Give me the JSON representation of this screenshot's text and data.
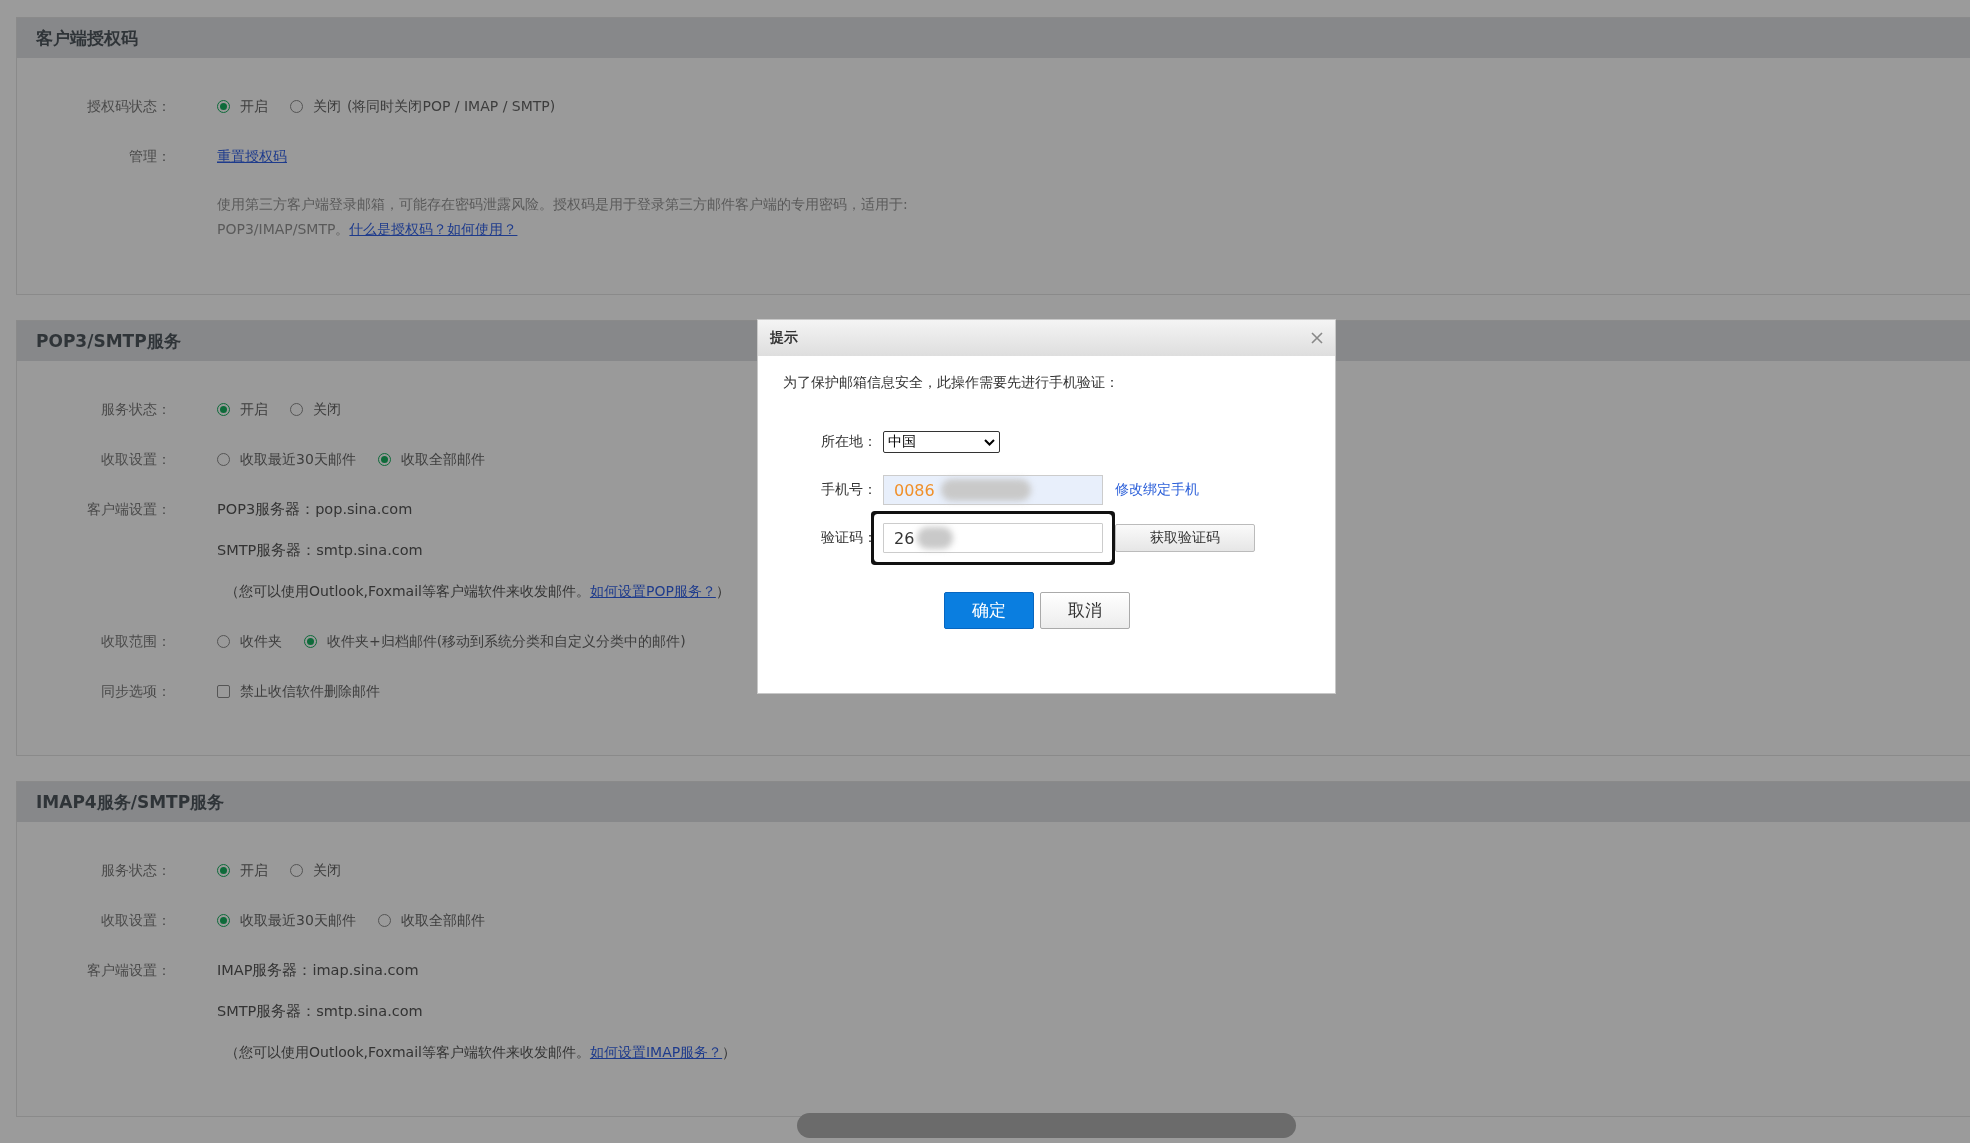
{
  "sections": [
    {
      "title": "客户端授权码",
      "rows": [
        {
          "kind": "radio",
          "label": "授权码状态：",
          "options": [
            {
              "label": "开启",
              "selected": true
            },
            {
              "label": "关闭",
              "selected": false,
              "note": "(将同时关闭POP / IMAP / SMTP)"
            }
          ]
        },
        {
          "kind": "link",
          "label": "管理：",
          "link": "重置授权码"
        },
        {
          "kind": "paragraph",
          "text": "使用第三方客户端登录邮箱，可能存在密码泄露风险。授权码是用于登录第三方邮件客户端的专用密码，适用于: POP3/IMAP/SMTP。",
          "link": "什么是授权码？如何使用？"
        }
      ]
    },
    {
      "title": "POP3/SMTP服务",
      "rows": [
        {
          "kind": "radio",
          "label": "服务状态：",
          "options": [
            {
              "label": "开启",
              "selected": true
            },
            {
              "label": "关闭",
              "selected": false
            }
          ]
        },
        {
          "kind": "radio",
          "label": "收取设置：",
          "options": [
            {
              "label": "收取最近30天邮件",
              "selected": false
            },
            {
              "label": "收取全部邮件",
              "selected": true
            }
          ]
        },
        {
          "kind": "servers",
          "label": "客户端设置：",
          "lines": [
            "POP3服务器：pop.sina.com",
            "SMTP服务器：smtp.sina.com"
          ],
          "note": {
            "before": "（您可以使用Outlook,Foxmail等客户端软件来收发邮件。",
            "link": "如何设置POP服务？",
            "after": "）"
          }
        },
        {
          "kind": "radio",
          "label": "收取范围：",
          "options": [
            {
              "label": "收件夹",
              "selected": false
            },
            {
              "label": "收件夹+归档邮件(移动到系统分类和自定义分类中的邮件)",
              "selected": true
            }
          ]
        },
        {
          "kind": "checkbox",
          "label": "同步选项：",
          "option": {
            "label": "禁止收信软件删除邮件",
            "checked": false
          }
        }
      ]
    },
    {
      "title": "IMAP4服务/SMTP服务",
      "rows": [
        {
          "kind": "radio",
          "label": "服务状态：",
          "options": [
            {
              "label": "开启",
              "selected": true
            },
            {
              "label": "关闭",
              "selected": false
            }
          ]
        },
        {
          "kind": "radio",
          "label": "收取设置：",
          "options": [
            {
              "label": "收取最近30天邮件",
              "selected": true
            },
            {
              "label": "收取全部邮件",
              "selected": false
            }
          ]
        },
        {
          "kind": "servers",
          "label": "客户端设置：",
          "lines": [
            "IMAP服务器：imap.sina.com",
            "SMTP服务器：smtp.sina.com"
          ],
          "note": {
            "before": "（您可以使用Outlook,Foxmail等客户端软件来收发邮件。",
            "link": "如何设置IMAP服务？",
            "after": "）"
          }
        }
      ]
    }
  ],
  "dialog": {
    "title": "提示",
    "message": "为了保护邮箱信息安全，此操作需要先进行手机验证：",
    "location": {
      "label": "所在地：",
      "value": "中国"
    },
    "phone": {
      "label": "手机号：",
      "value": "0086",
      "readonly": true,
      "link": "修改绑定手机"
    },
    "code": {
      "label": "验证码：",
      "value": "26",
      "focused": true,
      "button": "获取验证码"
    },
    "buttons": [
      {
        "label": "确定",
        "kind": "primary"
      },
      {
        "label": "取消",
        "kind": "secondary"
      }
    ]
  }
}
